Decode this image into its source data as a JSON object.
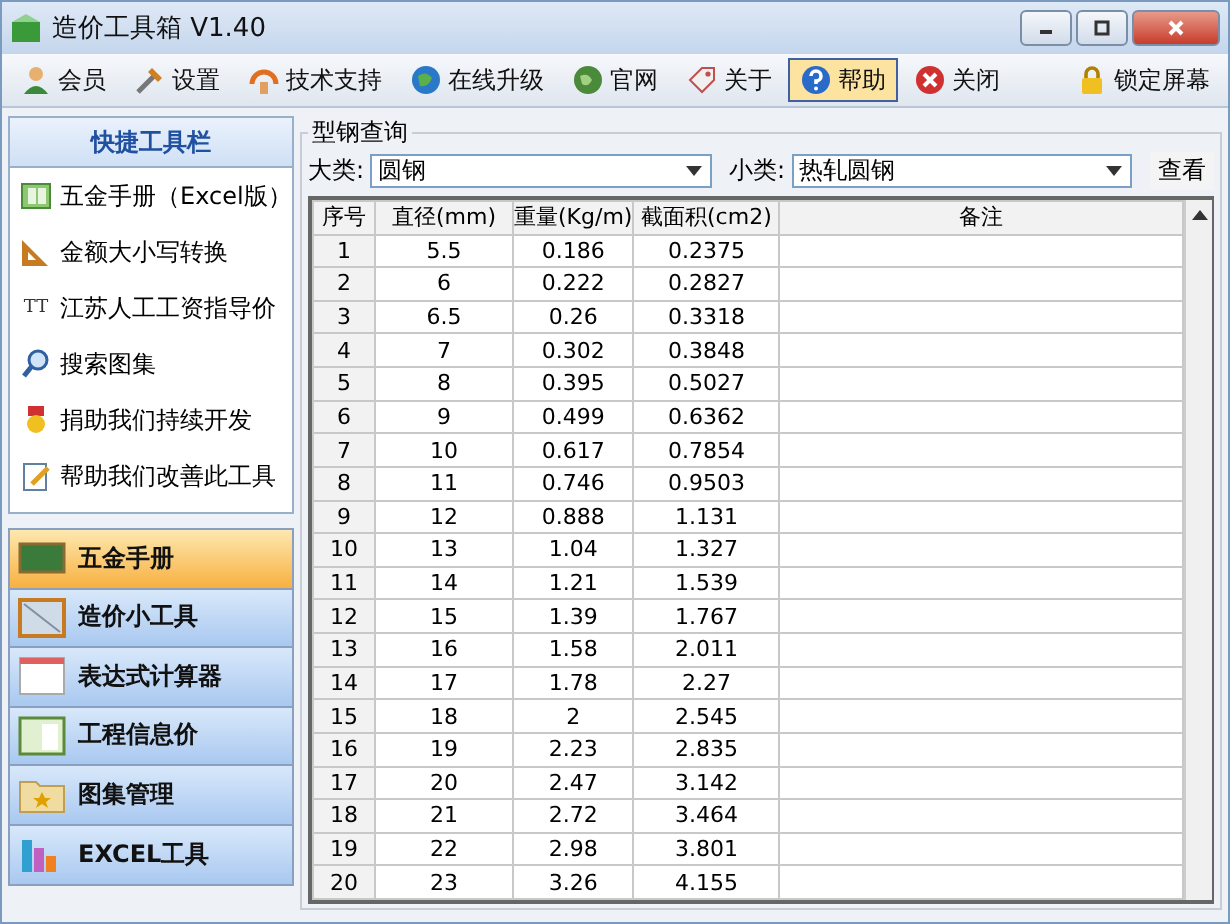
{
  "window": {
    "title": "造价工具箱 V1.40"
  },
  "toolbar": [
    {
      "label": "会员",
      "selected": false
    },
    {
      "label": "设置",
      "selected": false
    },
    {
      "label": "技术支持",
      "selected": false
    },
    {
      "label": "在线升级",
      "selected": false
    },
    {
      "label": "官网",
      "selected": false
    },
    {
      "label": "关于",
      "selected": false
    },
    {
      "label": "帮助",
      "selected": true
    },
    {
      "label": "关闭",
      "selected": false
    }
  ],
  "lock_button": "锁定屏幕",
  "quick_toolbar": {
    "title": "快捷工具栏",
    "items": [
      {
        "label": "五金手册（Excel版）"
      },
      {
        "label": "金额大小写转换"
      },
      {
        "label": "江苏人工工资指导价",
        "icon_text": "TT"
      },
      {
        "label": "搜索图集"
      },
      {
        "label": "捐助我们持续开发"
      },
      {
        "label": "帮助我们改善此工具"
      }
    ]
  },
  "nav": [
    {
      "label": "五金手册",
      "selected": true
    },
    {
      "label": "造价小工具",
      "selected": false
    },
    {
      "label": "表达式计算器",
      "selected": false
    },
    {
      "label": "工程信息价",
      "selected": false
    },
    {
      "label": "图集管理",
      "selected": false
    },
    {
      "label": "EXCEL工具",
      "selected": false
    }
  ],
  "query": {
    "title": "型钢查询",
    "category_label": "大类:",
    "category": "圆钢",
    "subcategory_label": "小类:",
    "subcategory": "热轧圆钢",
    "view_button": "查看"
  },
  "table": {
    "columns": [
      "序号",
      "直径(mm)",
      "重量(Kg/m)",
      "截面积(cm2)",
      "备注"
    ],
    "rows": [
      [
        "1",
        "5.5",
        "0.186",
        "0.2375"
      ],
      [
        "2",
        "6",
        "0.222",
        "0.2827"
      ],
      [
        "3",
        "6.5",
        "0.26",
        "0.3318"
      ],
      [
        "4",
        "7",
        "0.302",
        "0.3848"
      ],
      [
        "5",
        "8",
        "0.395",
        "0.5027"
      ],
      [
        "6",
        "9",
        "0.499",
        "0.6362"
      ],
      [
        "7",
        "10",
        "0.617",
        "0.7854"
      ],
      [
        "8",
        "11",
        "0.746",
        "0.9503"
      ],
      [
        "9",
        "12",
        "0.888",
        "1.131"
      ],
      [
        "10",
        "13",
        "1.04",
        "1.327"
      ],
      [
        "11",
        "14",
        "1.21",
        "1.539"
      ],
      [
        "12",
        "15",
        "1.39",
        "1.767"
      ],
      [
        "13",
        "16",
        "1.58",
        "2.011"
      ],
      [
        "14",
        "17",
        "1.78",
        "2.27"
      ],
      [
        "15",
        "18",
        "2",
        "2.545"
      ],
      [
        "16",
        "19",
        "2.23",
        "2.835"
      ],
      [
        "17",
        "20",
        "2.47",
        "3.142"
      ],
      [
        "18",
        "21",
        "2.72",
        "3.464"
      ],
      [
        "19",
        "22",
        "2.98",
        "3.801"
      ],
      [
        "20",
        "23",
        "3.26",
        "4.155"
      ]
    ]
  }
}
